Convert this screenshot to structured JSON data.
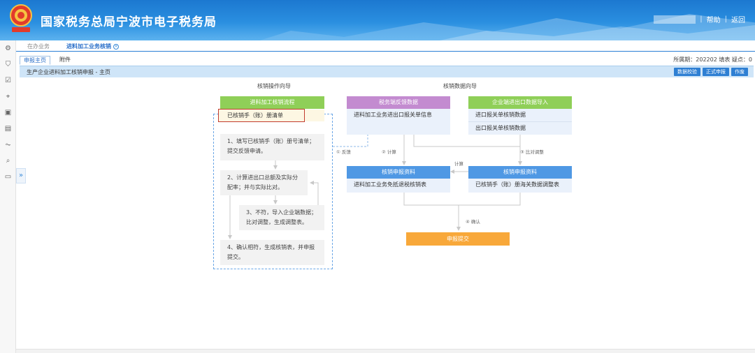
{
  "header": {
    "site_title": "国家税务总局宁波市电子税务局",
    "help_label": "帮助",
    "back_label": "返回",
    "divider": "|"
  },
  "top_tabs": [
    {
      "label": "在办业务"
    },
    {
      "label": "进料加工业务核销",
      "active": true
    }
  ],
  "sub_tabs": [
    {
      "label": "申报主页",
      "active": true
    },
    {
      "label": "附件"
    }
  ],
  "period_info": "所属期：202202  填表  疑点：0",
  "page_title": "生产企业进料加工核销申报 - 主页",
  "toolbar": {
    "data_check": "数据校验",
    "formal_submit": "正式申报",
    "void": "作废"
  },
  "sections": {
    "guide_label": "核销操作向导",
    "data_label": "核销数据向导"
  },
  "flow": {
    "process_head": "进料加工核销流程",
    "process_item": "已核销手（账）册清单",
    "steps": [
      "1、填写已核销手（账）册号清单；提交反馈申请。",
      "2、计算进出口总额及实际分配率；并与实际比对。",
      "3、不符，导入企业端数据；比对调整，生成调整表。",
      "4、确认相符，生成核销表，并申报提交。"
    ],
    "tax_head": "税务端反馈数据",
    "tax_item": "进料加工业务进出口报关单信息",
    "enterprise_head": "企业端进出口数据导入",
    "enterprise_items": [
      "进口报关单核销数据",
      "出口报关单核销数据"
    ],
    "report_head_left": "核销申报资料",
    "report_item_left": "进料加工业务免抵退税核销表",
    "report_head_right": "核销申报资料",
    "report_item_right": "已核销手（账）册海关数据调整表",
    "submit": "申报提交"
  },
  "arrow_labels": {
    "feedback": "① 反馈",
    "calc": "② 计算",
    "compare": "③ 比对调整",
    "calc2": "计算",
    "confirm": "④ 确认"
  },
  "colors": {
    "header_blue": "#1c78d0",
    "green": "#8fcf58",
    "purple": "#c38bd0",
    "blue": "#4f98e4",
    "orange": "#f8a83a",
    "highlight_border": "#c23b2e"
  }
}
